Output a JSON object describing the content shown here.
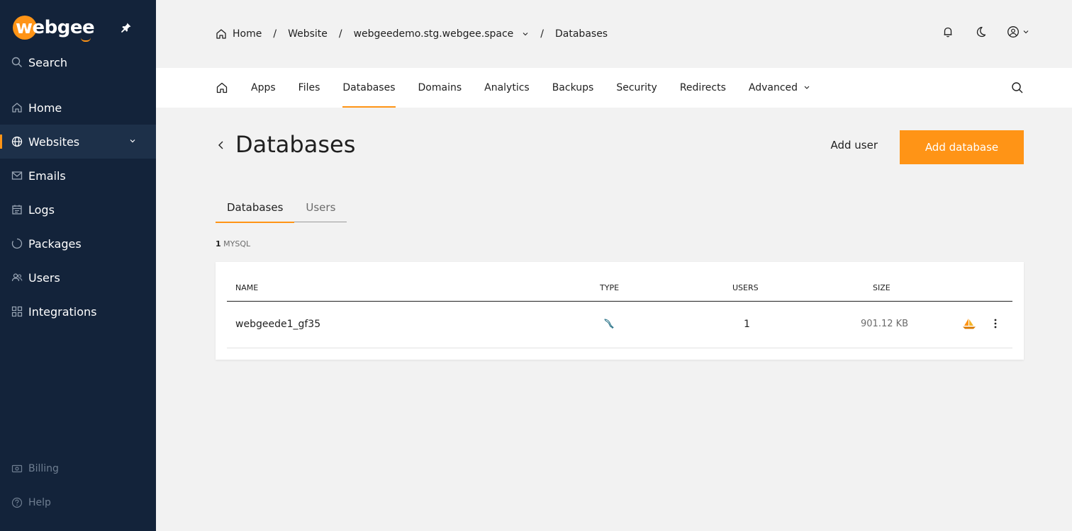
{
  "sidebar": {
    "logo": "webgee",
    "search_label": "Search",
    "items": [
      {
        "label": "Home"
      },
      {
        "label": "Websites"
      },
      {
        "label": "Emails"
      },
      {
        "label": "Logs"
      },
      {
        "label": "Packages"
      },
      {
        "label": "Users"
      },
      {
        "label": "Integrations"
      }
    ],
    "billing_label": "Billing",
    "help_label": "Help"
  },
  "breadcrumb": {
    "home": "Home",
    "website": "Website",
    "domain": "webgeedemo.stg.webgee.space",
    "current": "Databases",
    "separator": "/"
  },
  "tabs": {
    "items": [
      "Apps",
      "Files",
      "Databases",
      "Domains",
      "Analytics",
      "Backups",
      "Security",
      "Redirects",
      "Advanced"
    ],
    "active": "Databases"
  },
  "page": {
    "title": "Databases",
    "add_user_label": "Add user",
    "add_database_label": "Add database"
  },
  "subtabs": {
    "databases": "Databases",
    "users": "Users"
  },
  "summary": {
    "count": "1",
    "type": "MYSQL"
  },
  "table": {
    "headers": {
      "name": "NAME",
      "type": "TYPE",
      "users": "USERS",
      "size": "SIZE"
    },
    "rows": [
      {
        "name": "webgeede1_gf35",
        "type_icon": "mysql-dolphin-icon",
        "users": "1",
        "size": "901.12 KB"
      }
    ]
  },
  "colors": {
    "accent": "#ff9416",
    "sidebar_bg": "#13233a",
    "page_bg": "#f2f2f2"
  }
}
